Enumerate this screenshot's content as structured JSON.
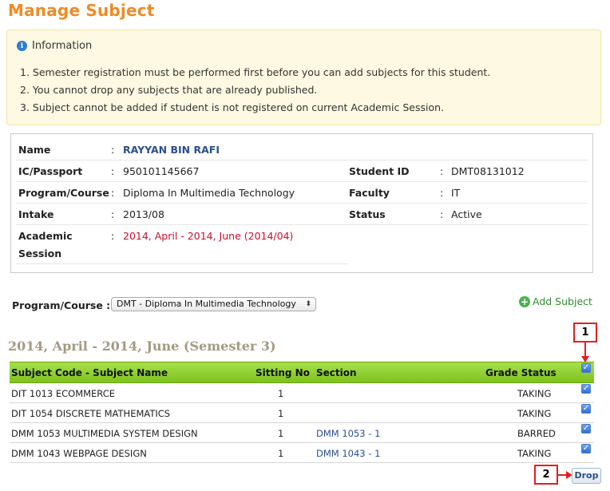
{
  "page": {
    "title": "Manage Subject"
  },
  "info": {
    "heading": "Information",
    "items": [
      "1.  Semester registration must be performed first before you can add subjects for this student.",
      "2.  You cannot drop any subjects that are already published.",
      "3.  Subject cannot be added if student is not registered on current Academic Session."
    ]
  },
  "student": {
    "name_label": "Name",
    "name": "RAYYAN BIN RAFI",
    "ic_label": "IC/Passport",
    "ic": "950101145667",
    "program_label": "Program/Course",
    "program": "Diploma In Multimedia Technology",
    "intake_label": "Intake",
    "intake": "2013/08",
    "session_label_1": "Academic",
    "session_label_2": "Session",
    "session": "2014, April - 2014, June (2014/04)",
    "student_id_label": "Student ID",
    "student_id": "DMT08131012",
    "faculty_label": "Faculty",
    "faculty": "IT",
    "status_label": "Status",
    "status": "Active",
    "colon": ":"
  },
  "program_select": {
    "label": "Program/Course :",
    "selected": "DMT - Diploma In Multimedia Technology",
    "arrow": "⬍"
  },
  "add_subject": {
    "label": "Add Subject",
    "icon": "+"
  },
  "semester_title": "2014, April - 2014, June (Semester 3)",
  "annotations": {
    "marker1": "1",
    "marker2": "2"
  },
  "table": {
    "headers": {
      "subject": "Subject Code - Subject Name",
      "sitting": "Sitting No",
      "section": "Section",
      "grade": "Grade Status"
    },
    "rows": [
      {
        "subject": "DIT 1013 ECOMMERCE",
        "sitting": "1",
        "section": "",
        "grade": "TAKING"
      },
      {
        "subject": "DIT 1054 DISCRETE MATHEMATICS",
        "sitting": "1",
        "section": "",
        "grade": "TAKING"
      },
      {
        "subject": "DMM 1053 MULTIMEDIA SYSTEM DESIGN",
        "sitting": "1",
        "section": "DMM 1053 - 1",
        "grade": "BARRED"
      },
      {
        "subject": "DMM 1043 WEBPAGE DESIGN",
        "sitting": "1",
        "section": "DMM 1043 - 1",
        "grade": "TAKING"
      }
    ],
    "check": "✓"
  },
  "drop_button": {
    "label": "Drop"
  },
  "colors": {
    "title": "#f08a24",
    "header_green": "#8ccc2a",
    "link_blue": "#2b4f8c",
    "marker_red": "#e02020"
  }
}
